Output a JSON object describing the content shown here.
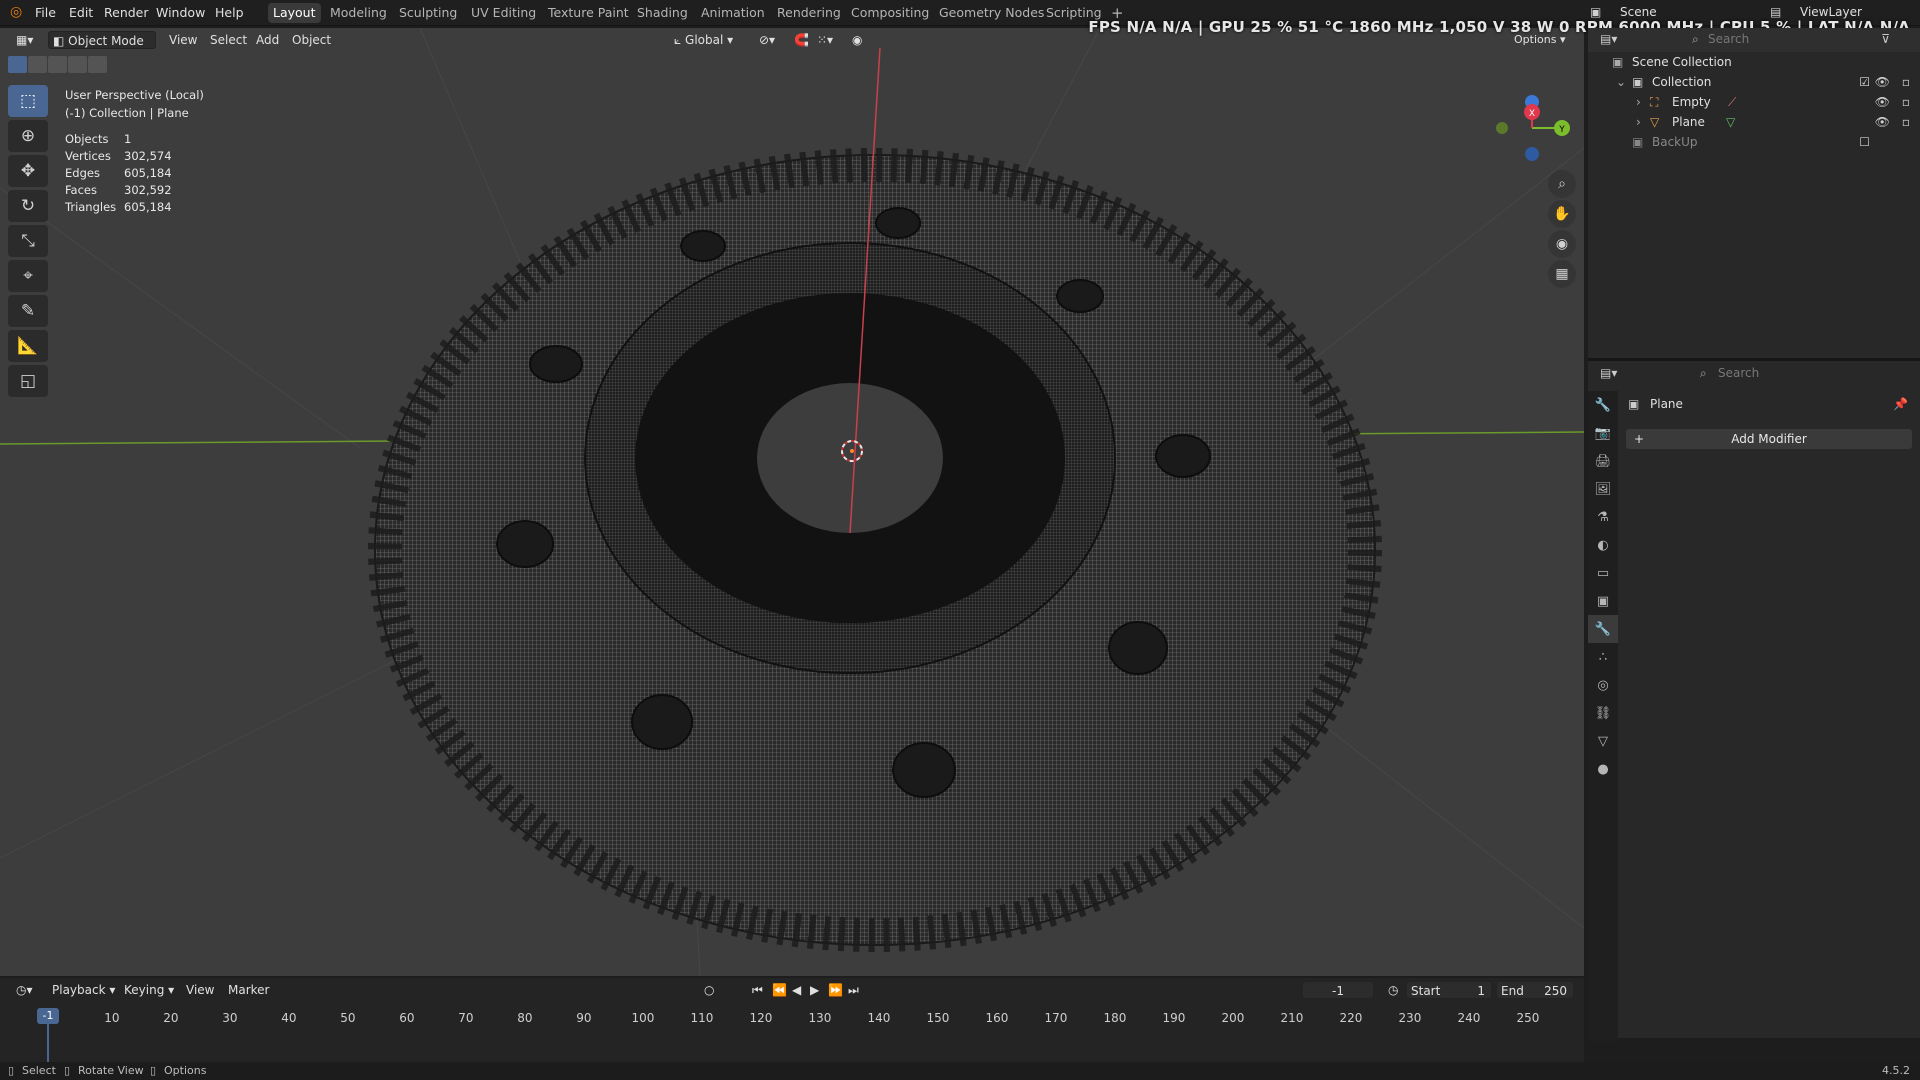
{
  "menu": {
    "items": [
      "File",
      "Edit",
      "Render",
      "Window",
      "Help"
    ]
  },
  "workspaces": {
    "tabs": [
      "Layout",
      "Modeling",
      "Sculpting",
      "UV Editing",
      "Texture Paint",
      "Shading",
      "Animation",
      "Rendering",
      "Compositing",
      "Geometry Nodes",
      "Scripting"
    ],
    "active": "Layout",
    "add_label": "+"
  },
  "stats_overlay": "FPS  N/A  N/A  |  GPU  25 %  51 °C  1860 MHz  1,050 V  38 W  0 RPM  6000 MHz  |  CPU  5 %  |  LAT  N/A  N/A",
  "scene_field": "Scene",
  "viewlayer_field": "ViewLayer",
  "top_search_placeholder": "Search",
  "viewport_header": {
    "mode": "Object Mode",
    "menus": [
      "View",
      "Select",
      "Add",
      "Object"
    ],
    "orientation": "Global",
    "options_label": "Options"
  },
  "viewport_info": {
    "line1": "User Perspective (Local)",
    "line2": "(-1) Collection | Plane"
  },
  "mesh_stats": [
    {
      "key": "Objects",
      "value": "1"
    },
    {
      "key": "Vertices",
      "value": "302,574"
    },
    {
      "key": "Edges",
      "value": "605,184"
    },
    {
      "key": "Faces",
      "value": "302,592"
    },
    {
      "key": "Triangles",
      "value": "605,184"
    }
  ],
  "gizmo_axes": {
    "x": "X",
    "y": "Y",
    "z": "Z"
  },
  "outliner": {
    "root": "Scene Collection",
    "collection": "Collection",
    "children": [
      "Empty",
      "Plane"
    ],
    "backup": "BackUp"
  },
  "properties": {
    "search_placeholder": "Search",
    "object_name": "Plane",
    "add_modifier": "Add Modifier"
  },
  "timeline": {
    "menus": [
      "Playback",
      "Keying",
      "View",
      "Marker"
    ],
    "current_frame": "-1",
    "frame_field": "-1",
    "start_label": "Start",
    "start_value": "1",
    "end_label": "End",
    "end_value": "250",
    "ticks": [
      "10",
      "20",
      "30",
      "40",
      "50",
      "60",
      "70",
      "80",
      "90",
      "100",
      "110",
      "120",
      "130",
      "140",
      "150",
      "160",
      "170",
      "180",
      "190",
      "200",
      "210",
      "220",
      "230",
      "240",
      "250"
    ]
  },
  "status": {
    "select": "Select",
    "rotate": "Rotate View",
    "options": "Options",
    "version": "4.5.2"
  },
  "colors": {
    "accent": "#4a6794",
    "x_axis": "#e2384c",
    "y_axis": "#7bbd2c",
    "z_axis": "#3b78d8"
  }
}
